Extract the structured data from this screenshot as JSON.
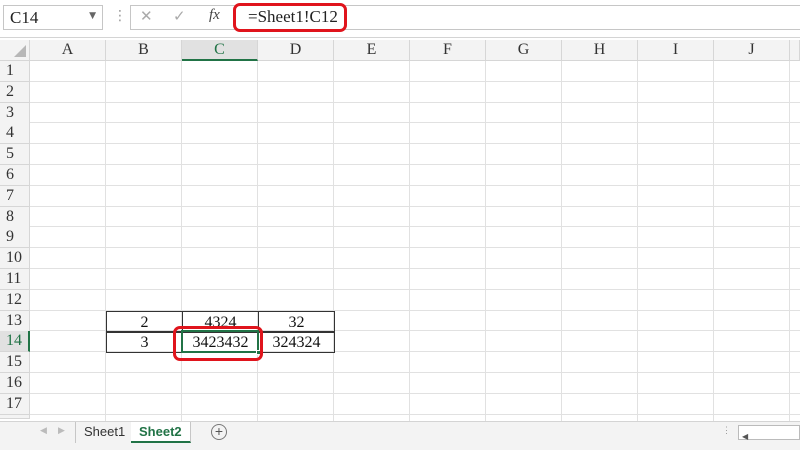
{
  "formula_bar": {
    "name_box": "C14",
    "formula": "=Sheet1!C12",
    "fx_label": "fx"
  },
  "columns": [
    "A",
    "B",
    "C",
    "D",
    "E",
    "F",
    "G",
    "H",
    "I",
    "J"
  ],
  "selected_column": "C",
  "rows": [
    "1",
    "2",
    "3",
    "4",
    "5",
    "6",
    "7",
    "8",
    "9",
    "10",
    "11",
    "12",
    "13",
    "14",
    "15",
    "16",
    "17"
  ],
  "selected_row": "14",
  "cells": {
    "B13": "2",
    "C13": "4324",
    "D13": "32",
    "B14": "3",
    "C14": "3423432",
    "D14": "324324"
  },
  "sheets": [
    {
      "label": "Sheet1",
      "active": false
    },
    {
      "label": "Sheet2",
      "active": true
    }
  ],
  "highlight_color": "#e0141c",
  "accent_color": "#217346"
}
